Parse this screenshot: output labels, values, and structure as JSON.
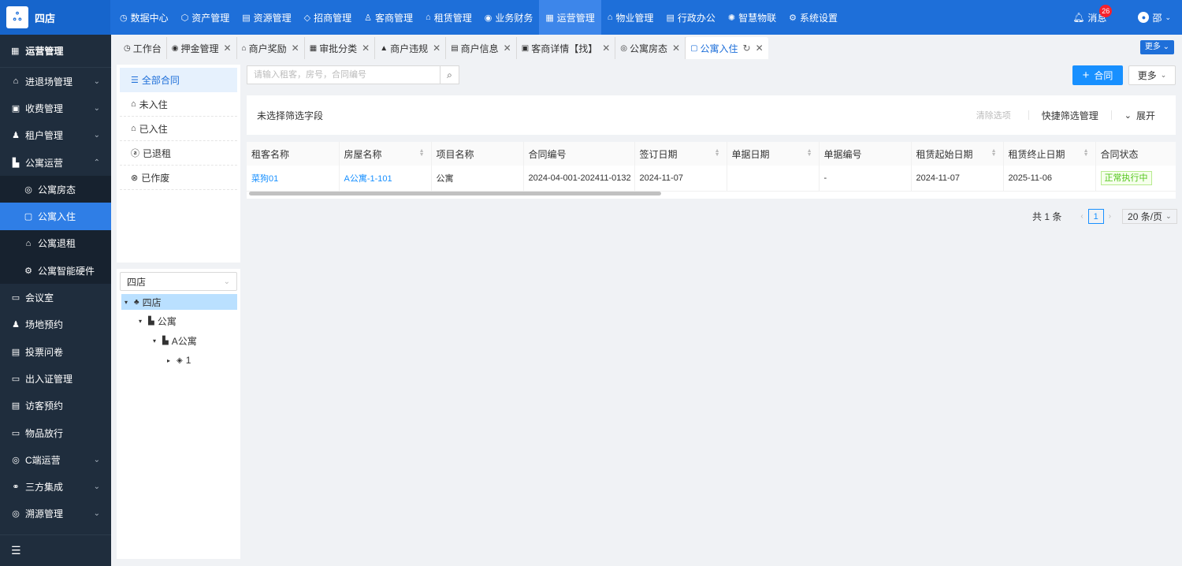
{
  "app": {
    "logo_glyph": "ஃ",
    "name": "四店"
  },
  "topnav": [
    {
      "icon": "◷",
      "label": "数据中心"
    },
    {
      "icon": "⬡",
      "label": "资产管理"
    },
    {
      "icon": "▤",
      "label": "资源管理"
    },
    {
      "icon": "◇",
      "label": "招商管理"
    },
    {
      "icon": "♙",
      "label": "客商管理"
    },
    {
      "icon": "⌂",
      "label": "租赁管理"
    },
    {
      "icon": "◉",
      "label": "业务财务"
    },
    {
      "icon": "▦",
      "label": "运营管理",
      "active": true
    },
    {
      "icon": "⌂",
      "label": "物业管理"
    },
    {
      "icon": "▤",
      "label": "行政办公"
    },
    {
      "icon": "✺",
      "label": "智慧物联"
    },
    {
      "icon": "⚙",
      "label": "系统设置"
    }
  ],
  "topright": {
    "messages_label": "消息",
    "messages_count": "26",
    "user_name": "邵"
  },
  "sidebar": {
    "header": "运营管理",
    "items": [
      {
        "icon": "⌂",
        "label": "进退场管理",
        "arrow": "⌄"
      },
      {
        "icon": "▣",
        "label": "收费管理",
        "arrow": "⌄"
      },
      {
        "icon": "♟",
        "label": "租户管理",
        "arrow": "⌄"
      },
      {
        "icon": "▙",
        "label": "公寓运营",
        "arrow": "⌃"
      }
    ],
    "subitems": [
      {
        "icon": "◎",
        "label": "公寓房态"
      },
      {
        "icon": "▢",
        "label": "公寓入住",
        "active": true
      },
      {
        "icon": "⌂",
        "label": "公寓退租"
      },
      {
        "icon": "⚙",
        "label": "公寓智能硬件"
      }
    ],
    "items2": [
      {
        "icon": "▭",
        "label": "会议室"
      },
      {
        "icon": "♟",
        "label": "场地预约"
      },
      {
        "icon": "▤",
        "label": "投票问卷"
      },
      {
        "icon": "▭",
        "label": "出入证管理"
      },
      {
        "icon": "▤",
        "label": "访客预约"
      },
      {
        "icon": "▭",
        "label": "物品放行"
      },
      {
        "icon": "◎",
        "label": "C端运营",
        "arrow": "⌄"
      },
      {
        "icon": "⚭",
        "label": "三方集成",
        "arrow": "⌄"
      },
      {
        "icon": "◎",
        "label": "溯源管理",
        "arrow": "⌄"
      }
    ],
    "collapse_icon": "☰"
  },
  "tabs": [
    {
      "icon": "◷",
      "label": "工作台",
      "close": ""
    },
    {
      "icon": "◉",
      "label": "押金管理",
      "close": "✕"
    },
    {
      "icon": "⌂",
      "label": "商户奖励",
      "close": "✕"
    },
    {
      "icon": "▦",
      "label": "审批分类",
      "close": "✕"
    },
    {
      "icon": "▲",
      "label": "商户违规",
      "close": "✕"
    },
    {
      "icon": "▤",
      "label": "商户信息",
      "close": "✕"
    },
    {
      "icon": "▣",
      "label": "客商详情【找】",
      "close": "✕"
    },
    {
      "icon": "◎",
      "label": "公寓房态",
      "close": "✕"
    },
    {
      "icon": "▢",
      "label": "公寓入住",
      "close": "✕",
      "active": true,
      "refresh": "↻"
    }
  ],
  "tabs_more": "更多 ⌄",
  "filters": [
    {
      "icon": "☰",
      "label": "全部合同",
      "active": true
    },
    {
      "icon": "⌂",
      "label": "未入住"
    },
    {
      "icon": "⌂",
      "label": "已入住"
    },
    {
      "icon": "ⓐ",
      "label": "已退租"
    },
    {
      "icon": "⊗",
      "label": "已作废"
    }
  ],
  "tree": {
    "select_value": "四店",
    "nodes": [
      {
        "tog": "▾",
        "icon": "♣",
        "label": "四店",
        "selected": true
      },
      {
        "tog": "▾",
        "icon": "▙",
        "label": "公寓"
      },
      {
        "tog": "▾",
        "icon": "▙",
        "label": "A公寓"
      },
      {
        "tog": "▸",
        "icon": "◈",
        "label": "1"
      }
    ]
  },
  "search": {
    "placeholder": "请输入租客，房号，合同编号",
    "value": ""
  },
  "actions": {
    "add_label": "合同",
    "more_label": "更多"
  },
  "filterbar": {
    "label": "未选择筛选字段",
    "clear": "清除选项",
    "quick": "快捷筛选管理",
    "expand": "展开"
  },
  "table": {
    "columns": [
      "租客名称",
      "房屋名称",
      "项目名称",
      "合同编号",
      "签订日期",
      "单据日期",
      "单据编号",
      "租赁起始日期",
      "租赁终止日期",
      "合同状态"
    ],
    "rows": [
      [
        "菜狗01",
        "A公寓-1-101",
        "公寓",
        "2024-04-001-202411-0132",
        "2024-11-07",
        "",
        "-",
        "2024-11-07",
        "2025-11-06",
        "正常执行中"
      ]
    ]
  },
  "pagination": {
    "total": "共 1 条",
    "page": "1",
    "page_size": "20 条/页"
  },
  "colors": {
    "primary": "#1e6fd9",
    "sidebar_bg": "#1f2d3d",
    "link": "#1890ff",
    "status_green": "#52c41a"
  }
}
